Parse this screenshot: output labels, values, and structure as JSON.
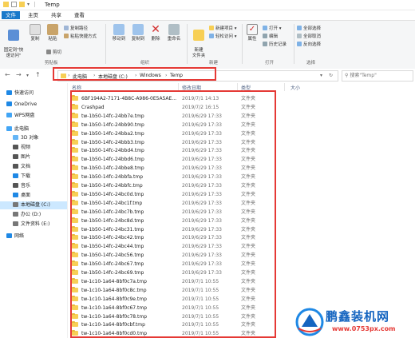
{
  "window": {
    "title": "Temp"
  },
  "tabs": [
    "文件",
    "主页",
    "共享",
    "查看"
  ],
  "ribbon": {
    "clipboard": {
      "pin": "固定到\"快\n速访问\"",
      "copy": "复制",
      "paste": "粘贴",
      "cut": "剪切",
      "copy_path": "复制路径",
      "paste_shortcut": "粘贴快捷方式",
      "group": "剪贴板"
    },
    "organize": {
      "move_to": "移动到",
      "copy_to": "复制到",
      "delete": "删除",
      "rename": "重命名",
      "group": "组织"
    },
    "new": {
      "new_folder": "新建\n文件夹",
      "new_item": "新建项目 ▾",
      "easy_access": "轻松访问 ▾",
      "group": "新建"
    },
    "open": {
      "properties": "属性",
      "open": "打开 ▾",
      "edit": "编辑",
      "history": "历史记录",
      "group": "打开"
    },
    "select": {
      "select_all": "全部选择",
      "select_none": "全部取消",
      "invert": "反向选择",
      "group": "选择"
    }
  },
  "address": {
    "crumbs": [
      "此电脑",
      "本地磁盘 (C:)",
      "Windows",
      "Temp"
    ],
    "search_placeholder": "搜索\"Temp\""
  },
  "nav": [
    {
      "label": "快速访问",
      "icon": "star-icon",
      "color": "#1e88e5"
    },
    {
      "label": "OneDrive",
      "icon": "cloud-icon",
      "color": "#1e88e5"
    },
    {
      "label": "WPS网盘",
      "icon": "cloud-icon",
      "color": "#42a5f5"
    },
    {
      "label": "此电脑",
      "icon": "computer-icon",
      "color": "#42a5f5"
    },
    {
      "label": "3D 对象",
      "icon": "cube-icon",
      "color": "#64b5f6"
    },
    {
      "label": "视频",
      "icon": "video-icon",
      "color": "#555555"
    },
    {
      "label": "图片",
      "icon": "picture-icon",
      "color": "#555555"
    },
    {
      "label": "文档",
      "icon": "document-icon",
      "color": "#555555"
    },
    {
      "label": "下载",
      "icon": "download-icon",
      "color": "#1e88e5"
    },
    {
      "label": "音乐",
      "icon": "music-icon",
      "color": "#555555"
    },
    {
      "label": "桌面",
      "icon": "desktop-icon",
      "color": "#1e88e5"
    },
    {
      "label": "本地磁盘 (C:)",
      "icon": "drive-icon",
      "color": "#777777"
    },
    {
      "label": "办公 (D:)",
      "icon": "drive-icon",
      "color": "#777777"
    },
    {
      "label": "文件资料 (E:)",
      "icon": "drive-icon",
      "color": "#777777"
    },
    {
      "label": "网络",
      "icon": "network-icon",
      "color": "#1e88e5"
    }
  ],
  "columns": [
    "名称",
    "修改日期",
    "类型",
    "大小"
  ],
  "files": [
    {
      "name": "6BF194A2-7171-4B8C-A986-0E5A5AE...",
      "date": "2019/7/1 14:13",
      "type": "文件夹"
    },
    {
      "name": "Crashpad",
      "date": "2019/7/2 16:15",
      "type": "文件夹"
    },
    {
      "name": "tw-1b50-14fc-24bb7e.tmp",
      "date": "2019/6/29 17:33",
      "type": "文件夹"
    },
    {
      "name": "tw-1b50-14fc-24bb90.tmp",
      "date": "2019/6/29 17:33",
      "type": "文件夹"
    },
    {
      "name": "tw-1b50-14fc-24bba2.tmp",
      "date": "2019/6/29 17:33",
      "type": "文件夹"
    },
    {
      "name": "tw-1b50-14fc-24bbb3.tmp",
      "date": "2019/6/29 17:33",
      "type": "文件夹"
    },
    {
      "name": "tw-1b50-14fc-24bbd4.tmp",
      "date": "2019/6/29 17:33",
      "type": "文件夹"
    },
    {
      "name": "tw-1b50-14fc-24bbd6.tmp",
      "date": "2019/6/29 17:33",
      "type": "文件夹"
    },
    {
      "name": "tw-1b50-14fc-24bbe8.tmp",
      "date": "2019/6/29 17:33",
      "type": "文件夹"
    },
    {
      "name": "tw-1b50-14fc-24bbfa.tmp",
      "date": "2019/6/29 17:33",
      "type": "文件夹"
    },
    {
      "name": "tw-1b50-14fc-24bbfc.tmp",
      "date": "2019/6/29 17:33",
      "type": "文件夹"
    },
    {
      "name": "tw-1b50-14fc-24bc0d.tmp",
      "date": "2019/6/29 17:33",
      "type": "文件夹"
    },
    {
      "name": "tw-1b50-14fc-24bc1f.tmp",
      "date": "2019/6/29 17:33",
      "type": "文件夹"
    },
    {
      "name": "tw-1b50-14fc-24bc7b.tmp",
      "date": "2019/6/29 17:33",
      "type": "文件夹"
    },
    {
      "name": "tw-1b50-14fc-24bc8d.tmp",
      "date": "2019/6/29 17:33",
      "type": "文件夹"
    },
    {
      "name": "tw-1b50-14fc-24bc31.tmp",
      "date": "2019/6/29 17:33",
      "type": "文件夹"
    },
    {
      "name": "tw-1b50-14fc-24bc42.tmp",
      "date": "2019/6/29 17:33",
      "type": "文件夹"
    },
    {
      "name": "tw-1b50-14fc-24bc44.tmp",
      "date": "2019/6/29 17:33",
      "type": "文件夹"
    },
    {
      "name": "tw-1b50-14fc-24bc56.tmp",
      "date": "2019/6/29 17:33",
      "type": "文件夹"
    },
    {
      "name": "tw-1b50-14fc-24bc67.tmp",
      "date": "2019/6/29 17:33",
      "type": "文件夹"
    },
    {
      "name": "tw-1b50-14fc-24bc69.tmp",
      "date": "2019/6/29 17:33",
      "type": "文件夹"
    },
    {
      "name": "tw-1c10-1a64-8bf0c7a.tmp",
      "date": "2019/7/1 10:55",
      "type": "文件夹"
    },
    {
      "name": "tw-1c10-1a64-8bf0c8c.tmp",
      "date": "2019/7/1 10:55",
      "type": "文件夹"
    },
    {
      "name": "tw-1c10-1a64-8bf0c9e.tmp",
      "date": "2019/7/1 10:55",
      "type": "文件夹"
    },
    {
      "name": "tw-1c10-1a64-8bf0c67.tmp",
      "date": "2019/7/1 10:55",
      "type": "文件夹"
    },
    {
      "name": "tw-1c10-1a64-8bf0c78.tmp",
      "date": "2019/7/1 10:55",
      "type": "文件夹"
    },
    {
      "name": "tw-1c10-1a64-8bf0cbf.tmp",
      "date": "2019/7/1 10:55",
      "type": "文件夹"
    },
    {
      "name": "tw-1c10-1a64-8bf0cd0.tmp",
      "date": "2019/7/1 10:55",
      "type": "文件夹"
    }
  ],
  "watermark": {
    "title": "鹏鑫装机网",
    "url": "www.0753px.com"
  },
  "colors": {
    "accent": "#1979ca",
    "highlight": "#e53935",
    "folder": "#f7cf55",
    "selected": "#cce8ff"
  }
}
